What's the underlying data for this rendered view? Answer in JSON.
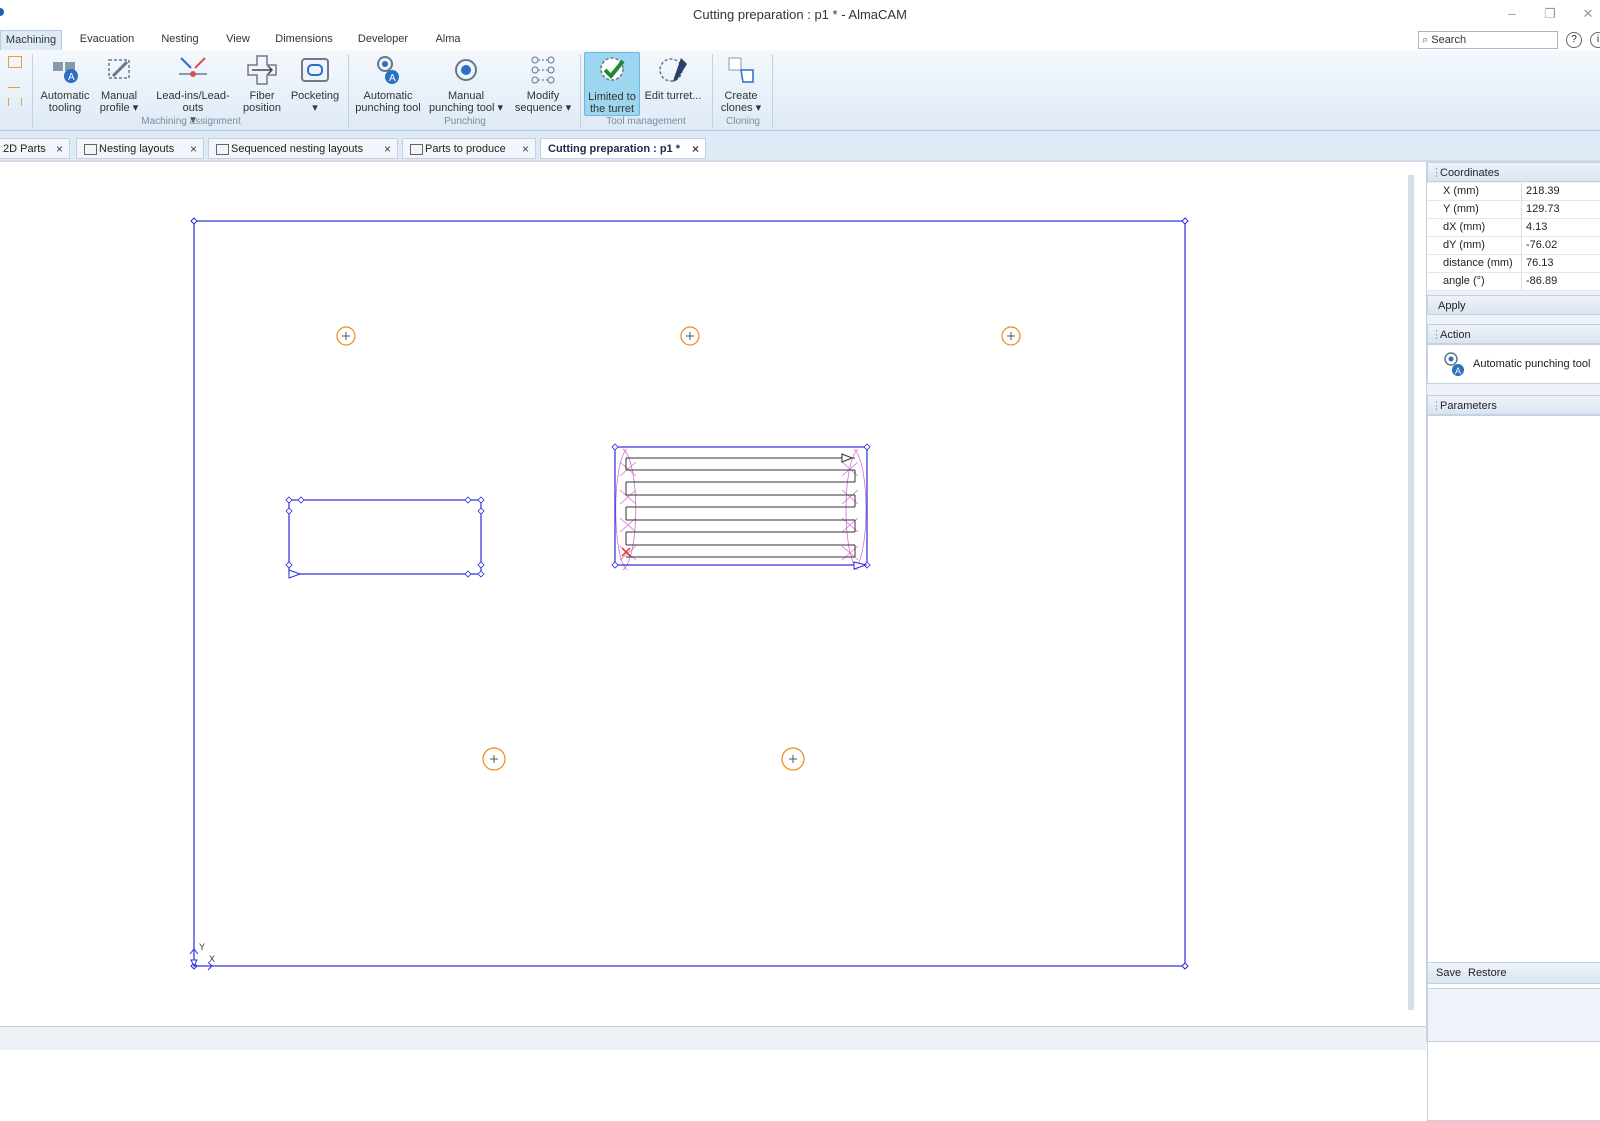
{
  "window": {
    "title": "Cutting preparation : p1 * - AlmaCAM",
    "minimize": "–",
    "restore": "❐",
    "close": "✕"
  },
  "ribbon_tabs": [
    "Machining",
    "Evacuation",
    "Nesting",
    "View",
    "Dimensions",
    "Developer",
    "Alma"
  ],
  "search": {
    "placeholder": "Search",
    "help": "?",
    "info": "i"
  },
  "ribbon": {
    "automatic_tooling": {
      "l1": "Automatic",
      "l2": "tooling"
    },
    "manual_profile": {
      "l1": "Manual",
      "l2": "profile ▾"
    },
    "lead_ins": {
      "l1": "Lead-ins/Lead-outs",
      "l2": "▾"
    },
    "fiber_position": {
      "l1": "Fiber",
      "l2": "position"
    },
    "pocketing": {
      "l1": "Pocketing",
      "l2": "▾"
    },
    "group_machining": "Machining assignment",
    "automatic_punching": {
      "l1": "Automatic",
      "l2": "punching tool"
    },
    "manual_punching": {
      "l1": "Manual",
      "l2": "punching tool ▾"
    },
    "modify_sequence": {
      "l1": "Modify",
      "l2": "sequence ▾"
    },
    "group_punching": "Punching",
    "limited_turret": {
      "l1": "Limited to",
      "l2": "the turret"
    },
    "edit_turret": {
      "l1": "Edit turret...",
      "l2": ""
    },
    "group_tool": "Tool management",
    "create_clones": {
      "l1": "Create",
      "l2": "clones ▾"
    },
    "group_cloning": "Cloning"
  },
  "doc_tabs": [
    {
      "label": "2D Parts"
    },
    {
      "label": "Nesting layouts"
    },
    {
      "label": "Sequenced nesting layouts"
    },
    {
      "label": "Parts to produce"
    },
    {
      "label": "Cutting preparation : p1 *"
    }
  ],
  "tab_close": "×",
  "axes": {
    "y": "Y",
    "x": "X"
  },
  "panel": {
    "coordinates_title": "Coordinates",
    "coordinates": [
      {
        "key": "X (mm)",
        "value": "218.39"
      },
      {
        "key": "Y (mm)",
        "value": "129.73"
      },
      {
        "key": "dX (mm)",
        "value": "4.13"
      },
      {
        "key": "dY (mm)",
        "value": "-76.02"
      },
      {
        "key": "distance (mm)",
        "value": "76.13"
      },
      {
        "key": "angle (°)",
        "value": "-86.89"
      }
    ],
    "apply": "Apply",
    "action_title": "Action",
    "action_value": "Automatic punching tool",
    "parameters_title": "Parameters",
    "save": "Save",
    "restore": "Restore"
  },
  "colors": {
    "part_outline": "#2b2bdc",
    "hole": "#ef8a1a",
    "punch": "#d070d0",
    "accent": "#1f5fb4"
  }
}
